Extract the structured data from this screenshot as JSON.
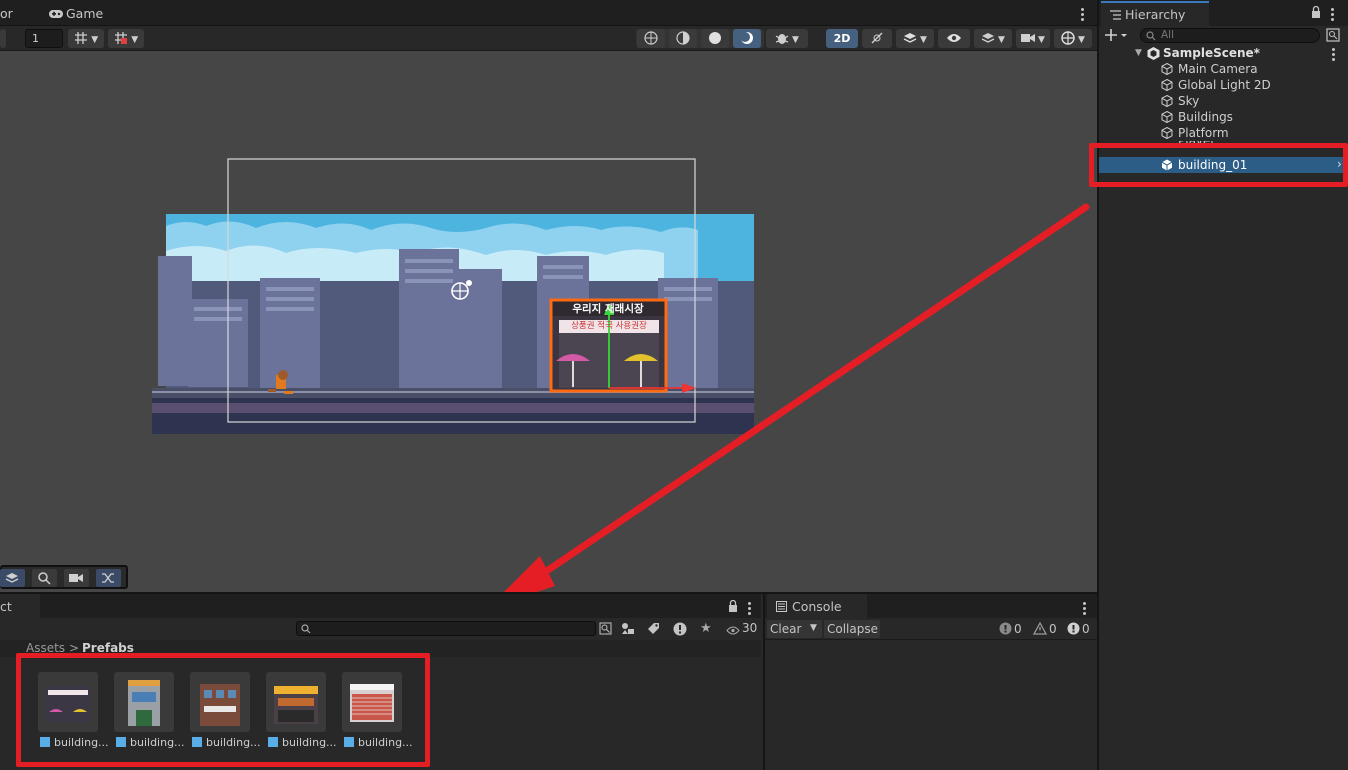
{
  "scene_tabs": {
    "tab_left_fragment": "or",
    "game_tab": "Game"
  },
  "scene_toolbar": {
    "grid_value": "1",
    "mode_2d": "2D"
  },
  "scene": {
    "shop_sign": "우리지 재래시장",
    "shop_sign_2": "상품권 적극 사용권장"
  },
  "hierarchy": {
    "title": "Hierarchy",
    "search_placeholder": "All",
    "scene_name": "SampleScene*",
    "items": [
      {
        "label": "Main Camera"
      },
      {
        "label": "Global Light 2D"
      },
      {
        "label": "Sky"
      },
      {
        "label": "Buildings"
      },
      {
        "label": "Platform"
      },
      {
        "label": "Player"
      },
      {
        "label": "building_01"
      }
    ]
  },
  "project": {
    "tab": "ct",
    "breadcrumb_root": "Assets",
    "breadcrumb_sep": ">",
    "breadcrumb_current": "Prefabs",
    "hidden_count": "30",
    "assets": [
      {
        "label": "building..."
      },
      {
        "label": "building..."
      },
      {
        "label": "building..."
      },
      {
        "label": "building..."
      },
      {
        "label": "building..."
      }
    ]
  },
  "console": {
    "title": "Console",
    "clear": "Clear",
    "collapse": "Collapse",
    "error_count": "0",
    "warning_count": "0",
    "info_count": "0"
  },
  "colors": {
    "annotation_red": "#e51e25",
    "selection": "#2c5d87"
  }
}
